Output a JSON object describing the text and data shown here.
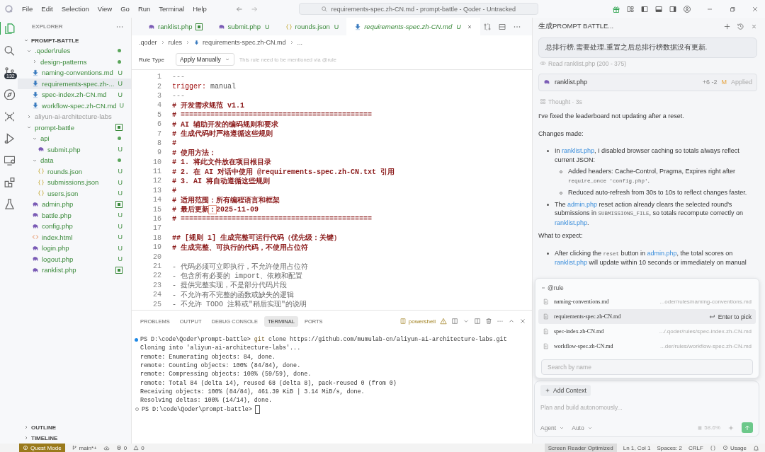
{
  "title_bar": {
    "menu": [
      "File",
      "Edit",
      "Selection",
      "View",
      "Go",
      "Run",
      "Terminal",
      "Help"
    ],
    "search": "requirements-spec.zh-CN.md - prompt-battle - Qoder - Untracked"
  },
  "activity_bar": [
    {
      "kind": "explorer",
      "selected": true
    },
    {
      "kind": "search",
      "selected": false
    },
    {
      "kind": "source-control",
      "selected": false,
      "badge": "132"
    },
    {
      "kind": "compass",
      "selected": false
    },
    {
      "kind": "graph",
      "selected": false
    },
    {
      "kind": "run",
      "selected": false
    },
    {
      "kind": "remote",
      "selected": false
    },
    {
      "kind": "extensions",
      "selected": false
    },
    {
      "kind": "testing",
      "selected": false
    }
  ],
  "explorer": {
    "title": "EXPLORER",
    "section": "PROMPT-BATTLE",
    "tree": [
      {
        "label": ".qoder\\rules",
        "kind": "folder",
        "expanded": true,
        "selected": false,
        "dimmed": false,
        "staged": false,
        "contains_changes": true,
        "children": [
          {
            "label": "design-patterns",
            "kind": "folder",
            "expanded": false,
            "selected": false,
            "dimmed": false,
            "staged": false,
            "contains_changes": true
          },
          {
            "label": "naming-conventions.md",
            "kind": "md",
            "selected": false,
            "dimmed": false,
            "staged": false,
            "badge": "U"
          },
          {
            "label": "requirements-spec.zh-...",
            "kind": "md",
            "selected": true,
            "dimmed": false,
            "staged": false,
            "badge": "U"
          },
          {
            "label": "spec-index.zh-CN.md",
            "kind": "md",
            "selected": false,
            "dimmed": false,
            "staged": false,
            "badge": "U"
          },
          {
            "label": "workflow-spec.zh-CN.md",
            "kind": "md",
            "selected": false,
            "dimmed": false,
            "staged": false,
            "badge": "U"
          }
        ]
      },
      {
        "label": "aliyun-ai-architecture-labs",
        "kind": "folder",
        "expanded": false,
        "selected": false,
        "dimmed": true,
        "staged": false,
        "contains_changes": false
      },
      {
        "label": "prompt-battle",
        "kind": "folder",
        "expanded": true,
        "selected": false,
        "dimmed": false,
        "staged": true,
        "contains_changes": true,
        "children": [
          {
            "label": "api",
            "kind": "folder",
            "expanded": true,
            "selected": false,
            "dimmed": false,
            "staged": false,
            "contains_changes": true,
            "children": [
              {
                "label": "submit.php",
                "kind": "php",
                "selected": false,
                "dimmed": false,
                "staged": false,
                "badge": "U"
              }
            ]
          },
          {
            "label": "data",
            "kind": "folder",
            "expanded": true,
            "selected": false,
            "dimmed": false,
            "staged": false,
            "contains_changes": true,
            "children": [
              {
                "label": "rounds.json",
                "kind": "json",
                "selected": false,
                "dimmed": false,
                "staged": false,
                "badge": "U"
              },
              {
                "label": "submissions.json",
                "kind": "json",
                "selected": false,
                "dimmed": false,
                "staged": false,
                "badge": "U"
              },
              {
                "label": "users.json",
                "kind": "json",
                "selected": false,
                "dimmed": false,
                "staged": false,
                "badge": "U"
              }
            ]
          },
          {
            "label": "admin.php",
            "kind": "php",
            "selected": false,
            "dimmed": false,
            "staged": true
          },
          {
            "label": "battle.php",
            "kind": "php",
            "selected": false,
            "dimmed": false,
            "staged": false,
            "badge": "U"
          },
          {
            "label": "config.php",
            "kind": "php",
            "selected": false,
            "dimmed": false,
            "staged": false,
            "badge": "U"
          },
          {
            "label": "index.html",
            "kind": "html",
            "selected": false,
            "dimmed": false,
            "staged": false,
            "badge": "U"
          },
          {
            "label": "login.php",
            "kind": "php",
            "selected": false,
            "dimmed": false,
            "staged": false,
            "badge": "U"
          },
          {
            "label": "logout.php",
            "kind": "php",
            "selected": false,
            "dimmed": false,
            "staged": false,
            "badge": "U"
          },
          {
            "label": "ranklist.php",
            "kind": "php",
            "selected": false,
            "dimmed": false,
            "staged": true
          }
        ]
      }
    ],
    "outline": "OUTLINE",
    "timeline": "TIMELINE"
  },
  "editor": {
    "tabs": [
      {
        "label": "ranklist.php",
        "kind": "php",
        "selected": false,
        "staged": true
      },
      {
        "label": "submit.php",
        "kind": "php",
        "selected": false,
        "staged": false,
        "badge": "U"
      },
      {
        "label": "rounds.json",
        "kind": "json",
        "selected": false,
        "staged": false,
        "badge": "U"
      },
      {
        "label": "requirements-spec.zh-CN.md",
        "kind": "md",
        "selected": true,
        "staged": false,
        "badge": "U"
      }
    ],
    "breadcrumb": [
      ".qoder",
      "rules",
      "requirements-spec.zh-CN.md",
      "..."
    ],
    "rule_type": {
      "label": "Rule Type",
      "value": "Apply Manually",
      "hint": "This rule need to be mentioned via @rule"
    },
    "lines": [
      {
        "num": "1",
        "tokens": [
          {
            "text": "---",
            "kind": "frontmatter"
          }
        ]
      },
      {
        "num": "2",
        "tokens": [
          {
            "text": "trigger:",
            "kind": "key"
          },
          {
            "text": " manual",
            "kind": "value"
          }
        ]
      },
      {
        "num": "3",
        "tokens": [
          {
            "text": "---",
            "kind": "frontmatter"
          }
        ]
      },
      {
        "num": "4",
        "tokens": [
          {
            "text": "# 开发需求规范 v1.1",
            "kind": "heading"
          }
        ]
      },
      {
        "num": "5",
        "tokens": [
          {
            "text": "# =============================================",
            "kind": "heading"
          }
        ]
      },
      {
        "num": "6",
        "tokens": [
          {
            "text": "# AI 辅助开发的编码规则和要求",
            "kind": "heading"
          }
        ]
      },
      {
        "num": "7",
        "tokens": [
          {
            "text": "# 生成代码时严格遵循这些规则",
            "kind": "heading"
          }
        ]
      },
      {
        "num": "8",
        "tokens": [
          {
            "text": "#",
            "kind": "heading"
          }
        ]
      },
      {
        "num": "9",
        "tokens": [
          {
            "text": "# 使用方法：",
            "kind": "heading"
          }
        ]
      },
      {
        "num": "10",
        "tokens": [
          {
            "text": "# 1. 将此文件放在项目根目录",
            "kind": "heading"
          }
        ]
      },
      {
        "num": "11",
        "tokens": [
          {
            "text": "# 2. 在 AI 对话中使用 @requirements-spec.zh-CN.txt 引用",
            "kind": "heading"
          }
        ]
      },
      {
        "num": "12",
        "tokens": [
          {
            "text": "# 3. AI 将自动遵循这些规则",
            "kind": "heading"
          }
        ]
      },
      {
        "num": "13",
        "tokens": [
          {
            "text": "#",
            "kind": "heading"
          }
        ]
      },
      {
        "num": "14",
        "tokens": [
          {
            "text": "# 适用范围：所有编程语言和框架",
            "kind": "heading"
          }
        ]
      },
      {
        "num": "15",
        "tokens": [
          {
            "text": "# 最后更新",
            "kind": "heading"
          },
          {
            "text": "：",
            "kind": "match"
          },
          {
            "text": "2025-11-09",
            "kind": "heading"
          }
        ]
      },
      {
        "num": "16",
        "tokens": [
          {
            "text": "# =============================================",
            "kind": "heading"
          }
        ]
      },
      {
        "num": "17"
      },
      {
        "num": "18",
        "tokens": [
          {
            "text": "## [规则 1] 生成完整可运行代码（优先级：关键）",
            "kind": "heading"
          }
        ]
      },
      {
        "num": "19",
        "tokens": [
          {
            "text": "# 生成完整、可执行的代码，不使用占位符",
            "kind": "heading"
          }
        ]
      },
      {
        "num": "20"
      },
      {
        "num": "21",
        "tokens": [
          {
            "text": "- 代码必须可立即执行，不允许使用占位符",
            "kind": "plain"
          }
        ]
      },
      {
        "num": "22",
        "tokens": [
          {
            "text": "- 包含所有必要的 import、依赖和配置",
            "kind": "plain"
          }
        ]
      },
      {
        "num": "23",
        "tokens": [
          {
            "text": "- 提供完整实现，不是部分代码片段",
            "kind": "plain"
          }
        ]
      },
      {
        "num": "24",
        "tokens": [
          {
            "text": "- 不允许有不完整的函数或缺失的逻辑",
            "kind": "plain"
          }
        ]
      },
      {
        "num": "25",
        "tokens": [
          {
            "text": "- 不允许 TODO 注释或\"稍后实现\"的说明",
            "kind": "plain"
          }
        ]
      }
    ]
  },
  "panel": {
    "tabs": [
      {
        "label": "PROBLEMS",
        "selected": false
      },
      {
        "label": "OUTPUT",
        "selected": false
      },
      {
        "label": "DEBUG CONSOLE",
        "selected": false
      },
      {
        "label": "TERMINAL",
        "selected": true
      },
      {
        "label": "PORTS",
        "selected": false
      }
    ],
    "shell": "powershell",
    "lines": [
      {
        "kind": "command",
        "succeeded": true,
        "prompt": "PS D:\\code\\Qoder\\prompt-battle>",
        "command": "git",
        "args": "clone https://github.com/mumulab-cn/aliyun-ai-architecture-labs.git"
      },
      {
        "kind": "output",
        "text": "Cloning into 'aliyun-ai-architecture-labs'..."
      },
      {
        "kind": "output",
        "text": "remote: Enumerating objects: 84, done."
      },
      {
        "kind": "output",
        "text": "remote: Counting objects: 100% (84/84), done."
      },
      {
        "kind": "output",
        "text": "remote: Compressing objects: 100% (59/59), done."
      },
      {
        "kind": "output",
        "text": "remote: Total 84 (delta 14), reused 68 (delta 8), pack-reused 0 (from 0)"
      },
      {
        "kind": "output",
        "text": "Receiving objects: 100% (84/84), 461.39 KiB | 3.14 MiB/s, done."
      },
      {
        "kind": "output",
        "text": "Resolving deltas: 100% (14/14), done."
      },
      {
        "kind": "prompt",
        "succeeded": false,
        "prompt": "PS D:\\code\\Qoder\\prompt-battle>"
      }
    ]
  },
  "chat": {
    "title": "生成PROMPT BATTLE...",
    "user_message": "总排行榜.需要处理.重置之后总排行榜数据没有更新.",
    "read": "Read ranklist.php (200 - 375)",
    "file_card": {
      "name": "ranklist.php",
      "diff": "+6 -2",
      "status": "M",
      "state": "Applied"
    },
    "thought": "Thought · 3s",
    "blocks": [
      {
        "kind": "paragraph",
        "segments": [
          {
            "kind": "text",
            "text": "I've fixed the leaderboard not updating after a reset."
          }
        ]
      },
      {
        "kind": "paragraph",
        "segments": [
          {
            "kind": "text",
            "text": "Changes made:"
          }
        ]
      },
      {
        "kind": "list",
        "items": [
          {
            "segments": [
              {
                "kind": "text",
                "text": "In "
              },
              {
                "kind": "link",
                "text": "ranklist.php"
              },
              {
                "kind": "text",
                "text": ", I disabled browser caching so totals always reflect current JSON:"
              }
            ],
            "children": [
              {
                "segments": [
                  {
                    "kind": "text",
                    "text": "Added headers: Cache-Control, Pragma, Expires right after "
                  },
                  {
                    "kind": "code",
                    "text": "require_once 'config.php'"
                  },
                  {
                    "kind": "text",
                    "text": "."
                  }
                ]
              },
              {
                "segments": [
                  {
                    "kind": "text",
                    "text": "Reduced auto-refresh from 30s to 10s to reflect changes faster."
                  }
                ]
              }
            ]
          },
          {
            "segments": [
              {
                "kind": "text",
                "text": "The "
              },
              {
                "kind": "link",
                "text": "admin.php"
              },
              {
                "kind": "text",
                "text": " reset action already clears the selected round's submissions in "
              },
              {
                "kind": "code",
                "text": "SUBMISSIONS_FILE"
              },
              {
                "kind": "text",
                "text": ", so totals recompute correctly on "
              },
              {
                "kind": "link",
                "text": "ranklist.php"
              },
              {
                "kind": "text",
                "text": "."
              }
            ]
          }
        ]
      },
      {
        "kind": "paragraph",
        "segments": [
          {
            "kind": "text",
            "text": "What to expect:"
          }
        ]
      },
      {
        "kind": "list",
        "items": [
          {
            "segments": [
              {
                "kind": "text",
                "text": "After clicking the "
              },
              {
                "kind": "code",
                "text": "reset"
              },
              {
                "kind": "text",
                "text": " button in "
              },
              {
                "kind": "link",
                "text": "admin.php"
              },
              {
                "kind": "text",
                "text": ", the total scores on "
              },
              {
                "kind": "link",
                "text": "ranklist.php"
              },
              {
                "kind": "text",
                "text": " will update within 10 seconds or immediately on manual"
              }
            ]
          }
        ]
      }
    ],
    "popup": {
      "title": "@rule",
      "items": [
        {
          "name": "naming-conventions.md",
          "path": "...oder/rules/naming-conventions.md",
          "selected": false
        },
        {
          "name": "requirements-spec.zh-CN.md",
          "hint": "Enter to pick",
          "selected": true
        },
        {
          "name": "spec-index.zh-CN.md",
          "path": ".../.qoder/rules/spec-index.zh-CN.md",
          "selected": false
        },
        {
          "name": "workflow-spec.zh-CN.md",
          "path": "...der/rules/workflow-spec.zh-CN.md",
          "selected": false
        }
      ],
      "search_placeholder": "Search by name"
    },
    "input": {
      "add_context": "Add Context",
      "placeholder": "Plan and build autonomously...",
      "mode": "Agent",
      "model": "Auto",
      "context_usage": "58.6%"
    }
  },
  "status_bar": {
    "mode": "Quest Mode",
    "branch": "main*+",
    "errors": "0",
    "warnings": "0",
    "screen_reader": "Screen Reader Optimized",
    "position": "Ln 1, Col 1",
    "indent": "Spaces: 2",
    "eol": "CRLF",
    "usage": "Usage"
  }
}
